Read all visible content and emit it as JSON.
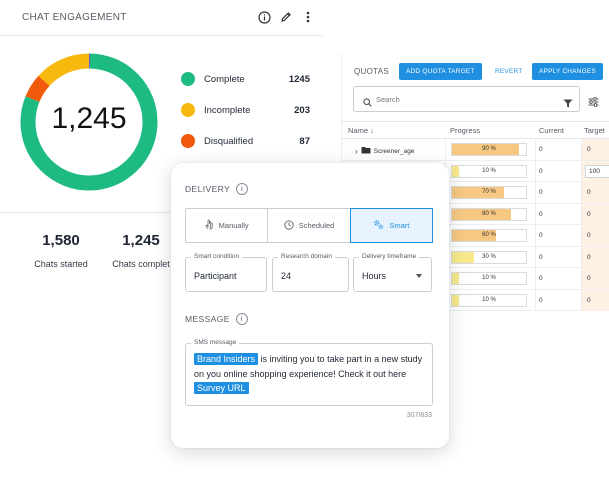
{
  "chat_engagement": {
    "title": "CHAT ENGAGEMENT",
    "total": "1,245",
    "legend": [
      {
        "label": "Complete",
        "count": "1245",
        "value": 1245,
        "color": "#1dbb82"
      },
      {
        "label": "Incomplete",
        "count": "203",
        "value": 203,
        "color": "#f8b90f"
      },
      {
        "label": "Disqualified",
        "count": "87",
        "value": 87,
        "color": "#f05a0a"
      }
    ],
    "donut_extra_color": "#6a5acd",
    "stats": [
      {
        "value": "1,580",
        "label": "Chats started"
      },
      {
        "value": "1,245",
        "label": "Chats complet"
      }
    ]
  },
  "quotas": {
    "title": "QUOTAS",
    "add_button": "ADD QUOTA TARGET",
    "revert_button": "REVERT",
    "apply_button": "APPLY CHANGES",
    "search_placeholder": "Search",
    "columns": {
      "name": "Name",
      "progress": "Progress",
      "current": "Current",
      "target": "Target"
    },
    "rows": [
      {
        "name": "Screener_age",
        "progress": 0.9,
        "progress_label": "90 %",
        "current": "0",
        "target": "0"
      },
      {
        "name": "",
        "progress": 0.1,
        "progress_label": "10 %",
        "current": "0",
        "target": "100"
      },
      {
        "name": "",
        "progress": 0.7,
        "progress_label": "70 %",
        "current": "0",
        "target": "0"
      },
      {
        "name": "",
        "progress": 0.8,
        "progress_label": "80 %",
        "current": "0",
        "target": "0"
      },
      {
        "name": "",
        "progress": 0.6,
        "progress_label": "60 %",
        "current": "0",
        "target": "0"
      },
      {
        "name": "",
        "progress": 0.3,
        "progress_label": "30 %",
        "current": "0",
        "target": "0"
      },
      {
        "name": "",
        "progress": 0.1,
        "progress_label": "10 %",
        "current": "0",
        "target": "0"
      },
      {
        "name": "",
        "progress": 0.1,
        "progress_label": "10 %",
        "current": "0",
        "target": "0"
      }
    ]
  },
  "delivery": {
    "heading": "DELIVERY",
    "options": [
      {
        "label": "Manually",
        "icon": "hand-icon"
      },
      {
        "label": "Scheduled",
        "icon": "clock-icon"
      },
      {
        "label": "Smart",
        "icon": "gears-icon",
        "active": true
      }
    ],
    "smart_condition": {
      "label": "Smart condition",
      "value": "Participant"
    },
    "research_domain": {
      "label": "Research domain",
      "value": "24"
    },
    "delivery_timeframe": {
      "label": "Delivery timeframe",
      "value": "Hours"
    },
    "message_heading": "MESSAGE",
    "sms_label": "SMS message",
    "message": {
      "chip_1": "Brand Insiders",
      "text_1": " is inviting you to take part in a new study on you online shopping experience! Check it out here ",
      "chip_2": "Survey URL"
    },
    "char_count": "307/833"
  }
}
